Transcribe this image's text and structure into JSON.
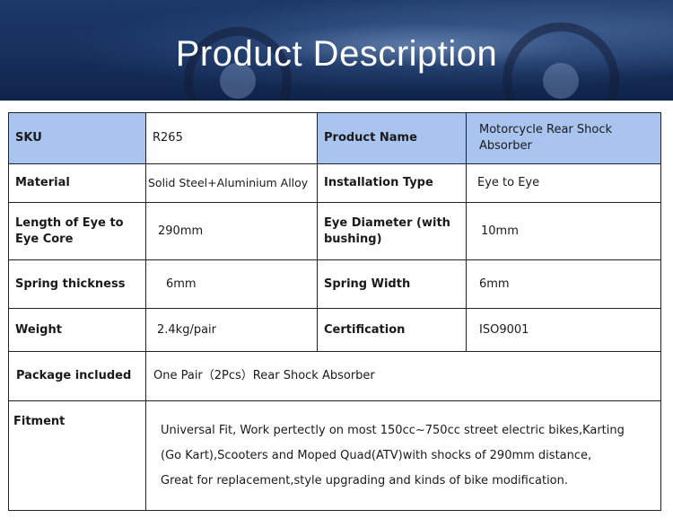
{
  "banner": {
    "title": "Product Description"
  },
  "rows": [
    {
      "label1": "SKU",
      "value1": "R265",
      "label2": "Product Name",
      "value2": "Motorcycle Rear Shock Absorber"
    },
    {
      "label1": "Material",
      "value1": "Solid Steel+Aluminium Alloy",
      "label2": "Installation Type",
      "value2": "Eye to Eye"
    },
    {
      "label1": "Length of Eye to Eye Core",
      "value1": "290mm",
      "label2": "Eye Diameter (with bushing)",
      "value2": "10mm"
    },
    {
      "label1": "Spring thickness",
      "value1": "6mm",
      "label2": "Spring Width",
      "value2": "6mm"
    },
    {
      "label1": "Weight",
      "value1": "2.4kg/pair",
      "label2": "Certification",
      "value2": "ISO9001"
    }
  ],
  "package": {
    "label": "Package included",
    "value": "One Pair（2Pcs）Rear  Shock Absorber"
  },
  "fitment": {
    "label": "Fitment",
    "lines": [
      "Universal Fit, Work pertectly on most 150cc~750cc street electric bikes,Karting",
      "(Go Kart),Scooters and Moped Quad(ATV)with shocks of  290mm distance,",
      "Great for  replacement,style upgrading and kinds of bike modification."
    ]
  },
  "colors": {
    "header_row": "#a9c4ee",
    "banner": "#1c3968"
  }
}
